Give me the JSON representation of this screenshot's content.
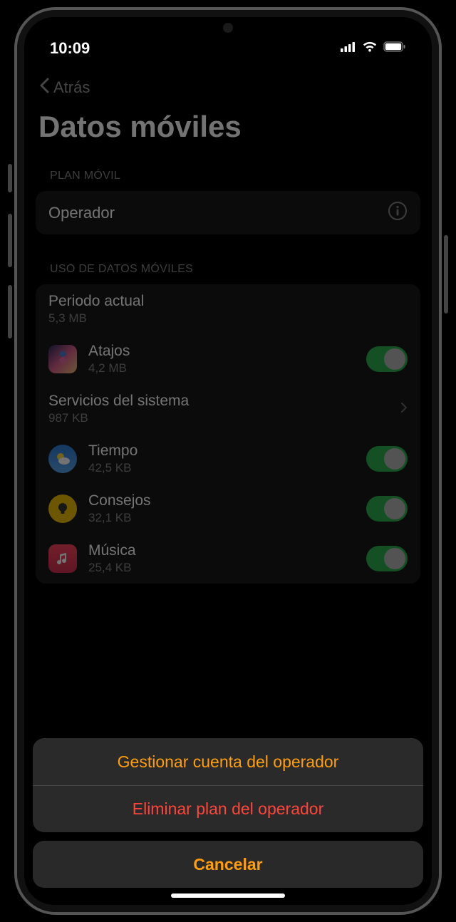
{
  "status": {
    "time": "10:09"
  },
  "nav": {
    "back": "Atrás",
    "title": "Datos móviles"
  },
  "sections": {
    "plan_label": "PLAN MÓVIL",
    "usage_label": "USO DE DATOS MÓVILES"
  },
  "plan": {
    "carrier": "Operador"
  },
  "usage": {
    "period": {
      "title": "Periodo actual",
      "amount": "5,3 MB"
    },
    "apps": [
      {
        "name": "Atajos",
        "amount": "4,2 MB",
        "toggle": true
      },
      {
        "name": "Servicios del sistema",
        "amount": "987 KB",
        "disclosure": true
      },
      {
        "name": "Tiempo",
        "amount": "42,5 KB",
        "toggle": true
      },
      {
        "name": "Consejos",
        "amount": "32,1 KB",
        "toggle": true
      },
      {
        "name": "Música",
        "amount": "25,4 KB",
        "toggle": true
      }
    ]
  },
  "sheet": {
    "manage": "Gestionar cuenta del operador",
    "remove": "Eliminar plan del operador",
    "cancel": "Cancelar"
  }
}
